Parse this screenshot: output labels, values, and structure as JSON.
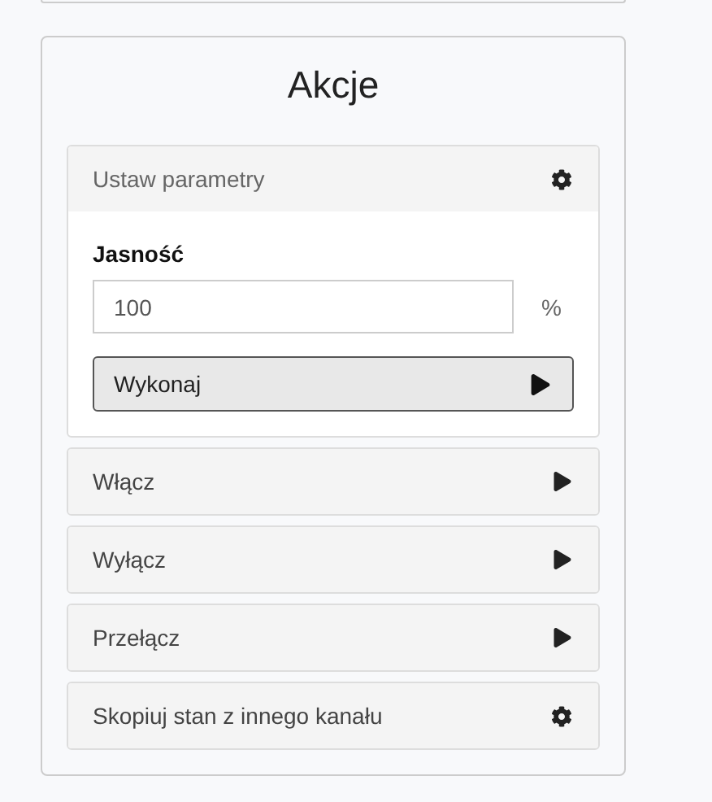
{
  "card": {
    "title": "Akcje"
  },
  "actions": [
    {
      "label": "Ustaw parametry",
      "kind": "configure",
      "expanded": true,
      "field": {
        "label": "Jasność",
        "value": "100",
        "unit": "%"
      },
      "button": "Wykonaj"
    },
    {
      "label": "Włącz",
      "kind": "run",
      "expanded": false
    },
    {
      "label": "Wyłącz",
      "kind": "run",
      "expanded": false
    },
    {
      "label": "Przełącz",
      "kind": "run",
      "expanded": false
    },
    {
      "label": "Skopiuj stan z innego kanału",
      "kind": "configure",
      "expanded": false
    }
  ]
}
